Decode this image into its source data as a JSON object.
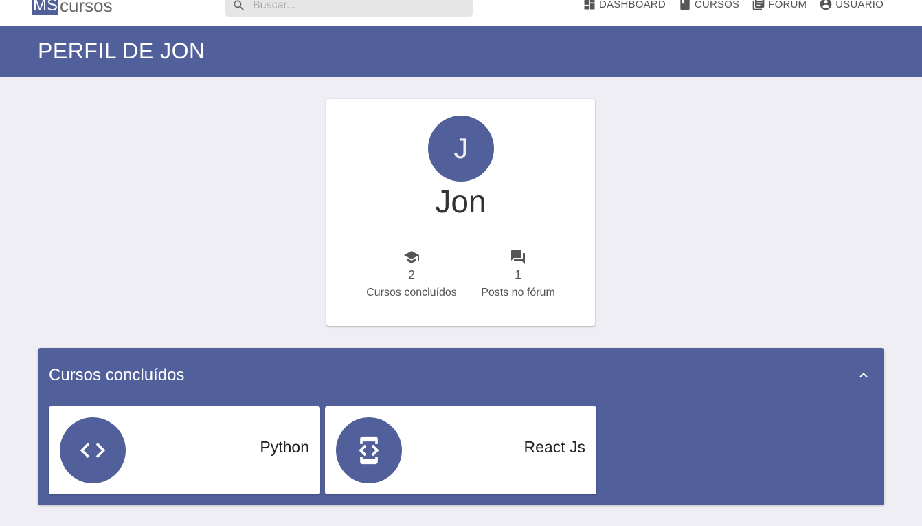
{
  "brand": {
    "logo_ms": "MS",
    "logo_text": "cursos"
  },
  "search": {
    "placeholder": "Buscar..."
  },
  "nav": {
    "items": [
      {
        "label": "DASHBOARD",
        "icon": "dashboard-icon"
      },
      {
        "label": "CURSOS",
        "icon": "book-icon"
      },
      {
        "label": "FORUM",
        "icon": "forum-list-icon"
      },
      {
        "label": "USUARIO",
        "icon": "account-circle-icon"
      }
    ]
  },
  "header": {
    "title": "PERFIL DE JON"
  },
  "profile": {
    "initial": "J",
    "name": "Jon",
    "stats": [
      {
        "value": "2",
        "label": "Cursos concluídos",
        "icon": "graduation-cap-icon"
      },
      {
        "value": "1",
        "label": "Posts no fórum",
        "icon": "forum-icon"
      }
    ]
  },
  "courses_panel": {
    "title": "Cursos concluídos",
    "courses": [
      {
        "name": "Python",
        "icon": "code-icon"
      },
      {
        "name": "React Js",
        "icon": "developer-mode-icon"
      }
    ]
  },
  "colors": {
    "primary": "#51609a",
    "background": "#efeef4"
  }
}
